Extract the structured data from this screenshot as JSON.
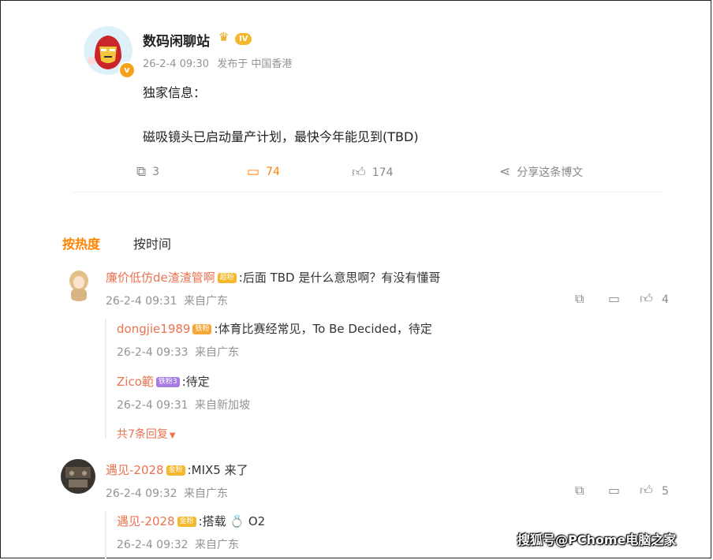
{
  "post": {
    "author": "数码闲聊站",
    "level_badge": "IV",
    "time": "26-2-4 09:30",
    "source": "发布于 中国香港",
    "text_line1": "独家信息：",
    "text_line2": "磁吸镜头已启动量产计划，最快今年能见到(TBD)",
    "reposts": "3",
    "comments": "74",
    "likes": "174",
    "share_label": "分享这条博文"
  },
  "sort": {
    "hot": "按热度",
    "time": "按时间"
  },
  "comments": [
    {
      "user": "廉价低仿de渣渣管啊",
      "badge": "超粉",
      "text": ":后面 TBD 是什么意思啊？有没有懂哥",
      "time": "26-2-4 09:31",
      "location": "来自广东",
      "likes": "4",
      "replies": [
        {
          "user": "dongjie1989",
          "badge": "铁粉",
          "text": ":体育比赛经常见，To Be Decided，待定",
          "time": "26-2-4 09:33",
          "location": "来自广东"
        },
        {
          "user": "Zico範",
          "badge": "铁粉3",
          "text": ":待定",
          "time": "26-2-4 09:31",
          "location": "来自新加坡"
        }
      ],
      "more_replies": "共7条回复"
    },
    {
      "user": "遇见-2028",
      "badge": "金粉",
      "text": ":MIX5 来了",
      "time": "26-2-4 09:32",
      "location": "来自广东",
      "likes": "5",
      "replies": [
        {
          "user": "遇见-2028",
          "badge": "金粉",
          "text": ":搭载 💍 O2",
          "time": "26-2-4 09:32",
          "location": "来自广东"
        }
      ]
    }
  ],
  "colors": {
    "accent": "#ff8200",
    "username": "#eb7350",
    "meta": "#939393"
  },
  "watermark": "搜狐号@PChome电脑之家"
}
